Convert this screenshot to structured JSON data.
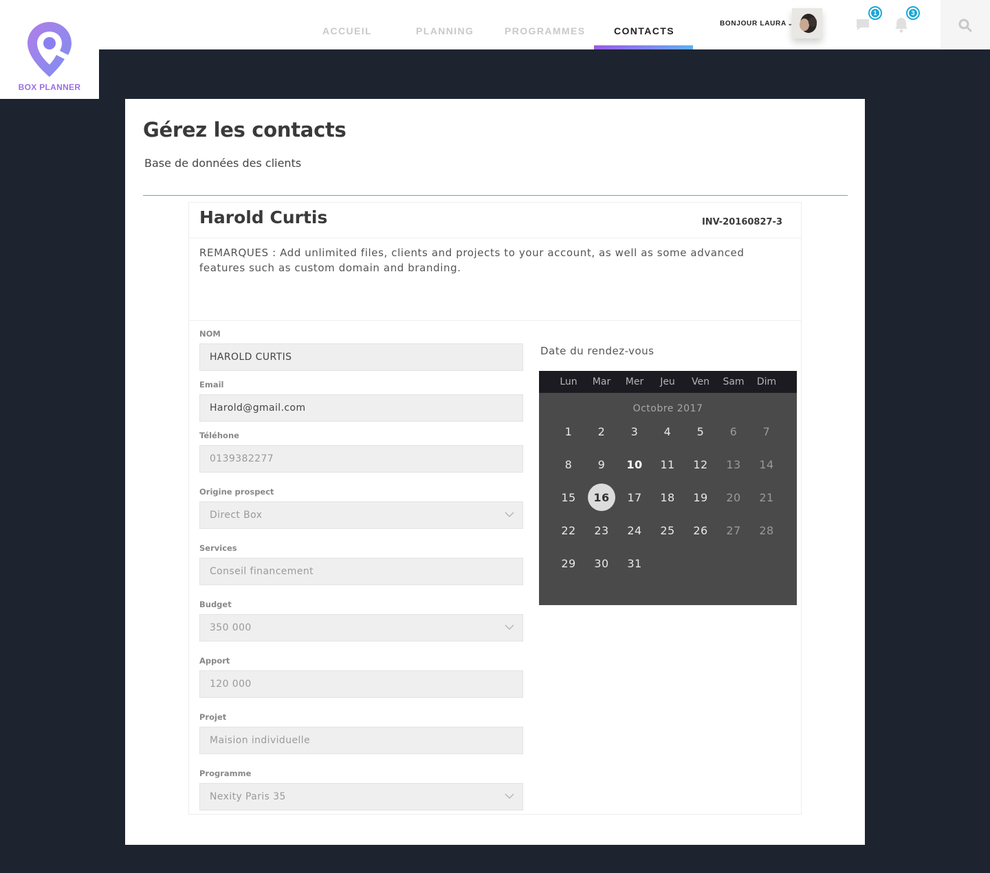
{
  "brand": {
    "name": "BOX PLANNER",
    "logo_icon": "map-pin-logo-icon",
    "accent": "#9b6ee6"
  },
  "nav": {
    "items": [
      {
        "label": "ACCUEIL",
        "active": false
      },
      {
        "label": "PLANNING",
        "active": false
      },
      {
        "label": "PROGRAMMES",
        "active": false
      },
      {
        "label": "CONTACTS",
        "active": true
      }
    ]
  },
  "user": {
    "greeting": "BONJOUR LAURA",
    "chevron": "⌄"
  },
  "notifications": {
    "messages_count": "1",
    "alerts_count": "3",
    "badge_color": "#1ba7d6"
  },
  "page": {
    "title": "Gérez les contacts",
    "subtitle": "Base de données des clients"
  },
  "contact": {
    "name": "Harold Curtis",
    "invoice": "INV-20160827-3",
    "remarks": "REMARQUES : Add unlimited files, clients and projects to your account, as well as some advanced features such as custom domain and branding."
  },
  "form": {
    "nom": {
      "label": "NOM",
      "value": "HAROLD CURTIS"
    },
    "email": {
      "label": "Email",
      "value": "Harold@gmail.com"
    },
    "telephone": {
      "label": "Téléhone",
      "value": "0139382277"
    },
    "origine": {
      "label": "Origine prospect",
      "value": "Direct Box"
    },
    "services": {
      "label": "Services",
      "value": "Conseil financement"
    },
    "budget": {
      "label": "Budget",
      "value": "350 000"
    },
    "apport": {
      "label": "Apport",
      "value": "120 000"
    },
    "projet": {
      "label": "Projet",
      "value": "Maision individuelle"
    },
    "programme": {
      "label": "Programme",
      "value": "Nexity Paris 35"
    }
  },
  "calendar": {
    "title": "Date du rendez-vous",
    "weekdays": [
      "Lun",
      "Mar",
      "Mer",
      "Jeu",
      "Ven",
      "Sam",
      "Dim"
    ],
    "month": "Octobre 2017",
    "selected": 16,
    "days": [
      "1",
      "2",
      "3",
      "4",
      "5",
      "6",
      "7",
      "8",
      "9",
      "10",
      "11",
      "12",
      "13",
      "14",
      "15",
      "16",
      "17",
      "18",
      "19",
      "20",
      "21",
      "22",
      "23",
      "24",
      "25",
      "26",
      "27",
      "28",
      "29",
      "30",
      "31"
    ]
  }
}
